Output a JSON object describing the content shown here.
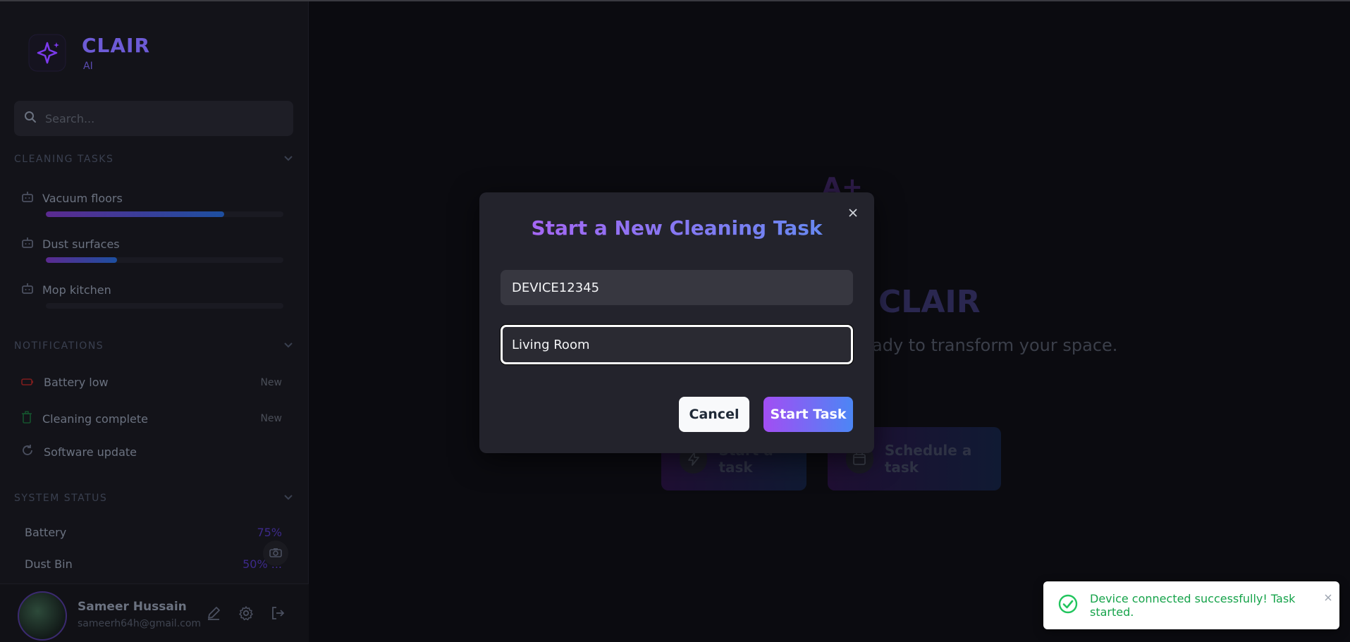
{
  "brand": {
    "name": "CLAIR",
    "sub": "AI"
  },
  "search": {
    "placeholder": "Search..."
  },
  "sections": {
    "tasks": "CLEANING TASKS",
    "notifications": "NOTIFICATIONS",
    "system": "SYSTEM STATUS"
  },
  "tasks": [
    {
      "label": "Vacuum floors",
      "progress": 0.75
    },
    {
      "label": "Dust surfaces",
      "progress": 0.3
    },
    {
      "label": "Mop kitchen",
      "progress": 0
    }
  ],
  "notifications": [
    {
      "label": "Battery low",
      "badge": "New",
      "icon": "battery-icon"
    },
    {
      "label": "Cleaning complete",
      "badge": "New",
      "icon": "trash-icon"
    },
    {
      "label": "Software update",
      "badge": "",
      "icon": "refresh-icon"
    }
  ],
  "system": [
    {
      "label": "Battery",
      "value": "75%"
    },
    {
      "label": "Dust Bin",
      "value": "50% ..."
    }
  ],
  "profile": {
    "name": "Sameer Hussain",
    "email": "sameerh64h@gmail.com"
  },
  "hero": {
    "aplus": "A+",
    "title": "CLAIR",
    "subtitle": "ady to transform your space.",
    "start_label": "Start a task",
    "schedule_label": "Schedule a task"
  },
  "modal": {
    "title": "Start a New Cleaning Task",
    "device_value": "DEVICE12345",
    "room_value": "Living Room",
    "cancel_label": "Cancel",
    "start_label": "Start Task"
  },
  "toast": {
    "message": "Device connected successfully! Task started."
  },
  "colors": {
    "accent_purple": "#a24ef3",
    "accent_blue": "#4c86f5",
    "success": "#16a34a"
  }
}
